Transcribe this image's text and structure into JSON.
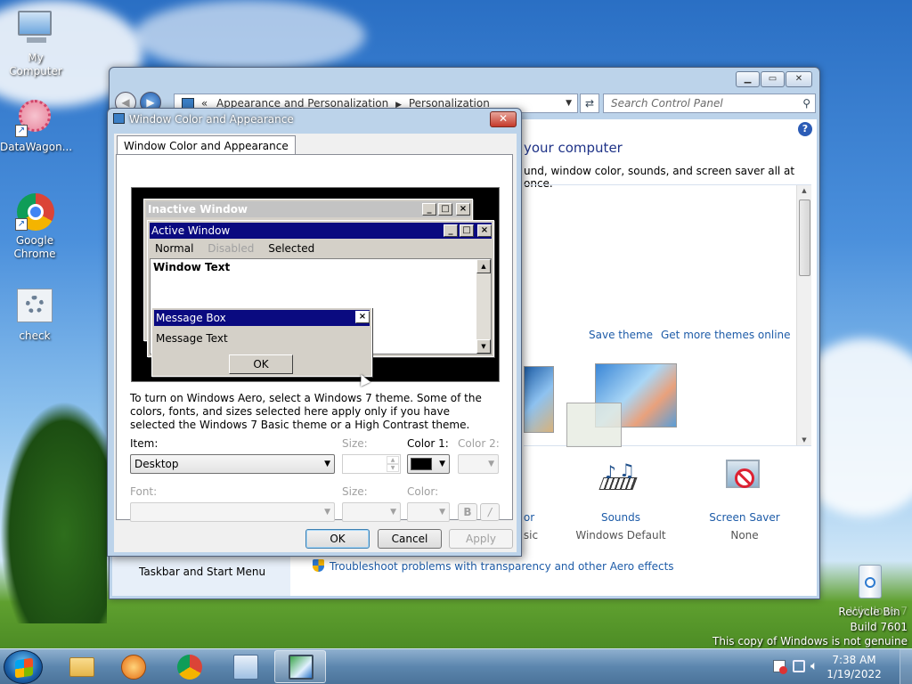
{
  "desktop": {
    "icons": [
      {
        "label": "My Computer",
        "icon": "computer-icon"
      },
      {
        "label": "DataWagon...",
        "icon": "datawagon-icon"
      },
      {
        "label": "Google Chrome",
        "icon": "chrome-icon"
      },
      {
        "label": "check",
        "icon": "check-settings-icon"
      }
    ],
    "recycle_bin": "Recycle Bin",
    "watermark": {
      "line1": "Windows 7",
      "line2": "Build 7601",
      "line3": "This copy of Windows is not genuine"
    }
  },
  "control_panel": {
    "breadcrumb": [
      "Appearance and Personalization",
      "Personalization"
    ],
    "breadcrumb_prefix": "«",
    "search_placeholder": "Search Control Panel",
    "heading": "your computer",
    "subheading": "und, window color, sounds, and screen saver all at once.",
    "save_theme": "Save theme",
    "get_more_themes": "Get more themes online",
    "items": [
      {
        "label": "or",
        "sub": "sic"
      },
      {
        "label": "Sounds",
        "sub": "Windows Default"
      },
      {
        "label": "Screen Saver",
        "sub": "None"
      }
    ],
    "taskbar_link": "Taskbar and Start Menu",
    "troubleshoot_link": "Troubleshoot problems with transparency and other Aero effects"
  },
  "dialog": {
    "title": "Window Color and Appearance",
    "tab": "Window Color and Appearance",
    "preview": {
      "inactive_window": "Inactive Window",
      "active_window": "Active Window",
      "menu": [
        "Normal",
        "Disabled",
        "Selected"
      ],
      "window_text": "Window Text",
      "message_box": "Message Box",
      "message_text": "Message Text",
      "ok": "OK"
    },
    "description": "To turn on Windows Aero, select a Windows 7 theme.  Some of the colors, fonts, and sizes selected here apply only if you have selected the Windows 7 Basic theme or a High Contrast theme.",
    "item_label": "Item:",
    "item_value": "Desktop",
    "size_label": "Size:",
    "color1_label": "Color 1:",
    "color2_label": "Color 2:",
    "font_label": "Font:",
    "font_size_label": "Size:",
    "font_color_label": "Color:",
    "bold": "B",
    "italic": "/",
    "color1_value": "#000000",
    "buttons": {
      "ok": "OK",
      "cancel": "Cancel",
      "apply": "Apply"
    }
  },
  "taskbar": {
    "time": "7:38 AM",
    "date": "1/19/2022"
  }
}
